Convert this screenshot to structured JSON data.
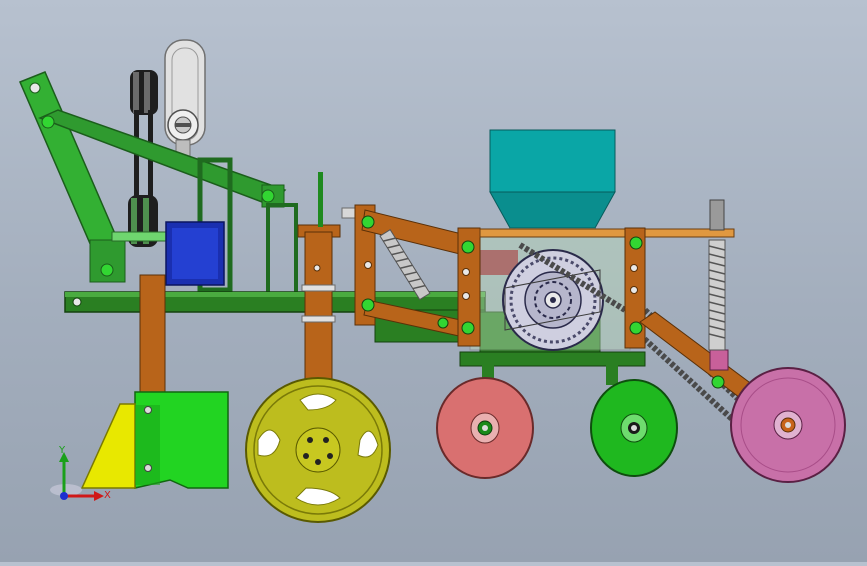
{
  "viewport": {
    "background_top": "#b7c1cf",
    "background_bottom": "#97a2b1"
  },
  "triad": {
    "x_label": "X",
    "y_label": "Y",
    "x_color": "#d01818",
    "y_color": "#1aa01a",
    "origin_color": "#1e2fd0"
  },
  "parts": {
    "three_point_hitch": {
      "color": "#2d8a2d"
    },
    "main_frame": {
      "color": "#2a7f22"
    },
    "blower_fan": {
      "color": "#dcdcdc"
    },
    "belt_pulleys": {
      "color": "#2a2a2a"
    },
    "gearbox": {
      "color": "#1a2fb0"
    },
    "seed_hopper": {
      "color": "#0aa6a6"
    },
    "metering_disc": {
      "color": "#c8c8d8"
    },
    "brackets": {
      "color": "#b8641a"
    },
    "springs": {
      "color": "#c8c8c8"
    },
    "furrow_opener": {
      "color": "#22c422"
    },
    "opener_tip": {
      "color": "#e8e800"
    },
    "drive_wheel": {
      "color": "#bdbd1e"
    },
    "front_press_wheel": {
      "color": "#d97070"
    },
    "middle_press_wheel": {
      "color": "#1fb81f"
    },
    "rear_press_wheel": {
      "color": "#c870a8"
    }
  }
}
